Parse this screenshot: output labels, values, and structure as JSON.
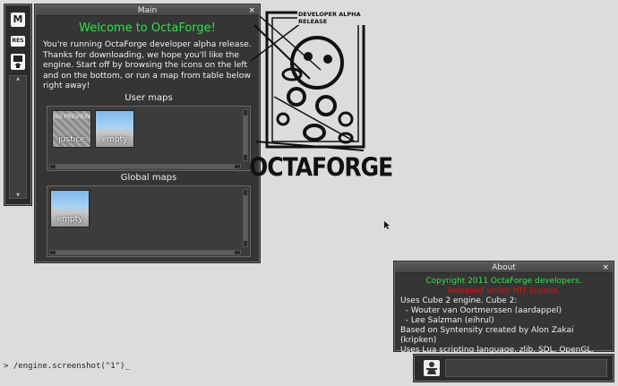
{
  "toolbar": {
    "menu_label": "M",
    "res_label": "RES",
    "icons": [
      "menu-icon",
      "resolution-icon",
      "bookmark-icon"
    ]
  },
  "main": {
    "title": "Main",
    "close": "×",
    "welcome": "Welcome to OctaForge!",
    "intro": "You're running OctaForge developer alpha release. Thanks for downloading, we hope you'll like the engine. Start off by browsing the icons on the left and on the bottom, or run a map from table below right away!",
    "user_maps_title": "User maps",
    "user_maps": [
      {
        "name": "justice",
        "preview": "NO PREVIEW"
      },
      {
        "name": "empty",
        "preview": ""
      }
    ],
    "global_maps_title": "Global maps",
    "global_maps": [
      {
        "name": "empty",
        "preview": ""
      }
    ]
  },
  "logo": {
    "tag": "DEVELOPER ALPHA RELEASE",
    "name": "OCTAFORGE"
  },
  "about": {
    "title": "About",
    "close": "×",
    "copyright": "Copyright 2011 OctaForge developers.",
    "license": "Released under MIT license.",
    "lines": [
      "Uses Cube 2 engine. Cube 2:",
      "  - Wouter van Oortmerssen (aardappel)",
      "  - Lee Salzman (eihrul)",
      "Based on Syntensity created by Alon Zakai (kripken)",
      "Uses Lua scripting language, zlib, SDL, OpenGL."
    ]
  },
  "console": {
    "text": "> /engine.screenshot(\"1\")_"
  },
  "colors": {
    "accent_green": "#2fe34a",
    "license_red": "#e01010",
    "panel_bg": "#353535",
    "desktop_bg": "#dcdcdc"
  }
}
